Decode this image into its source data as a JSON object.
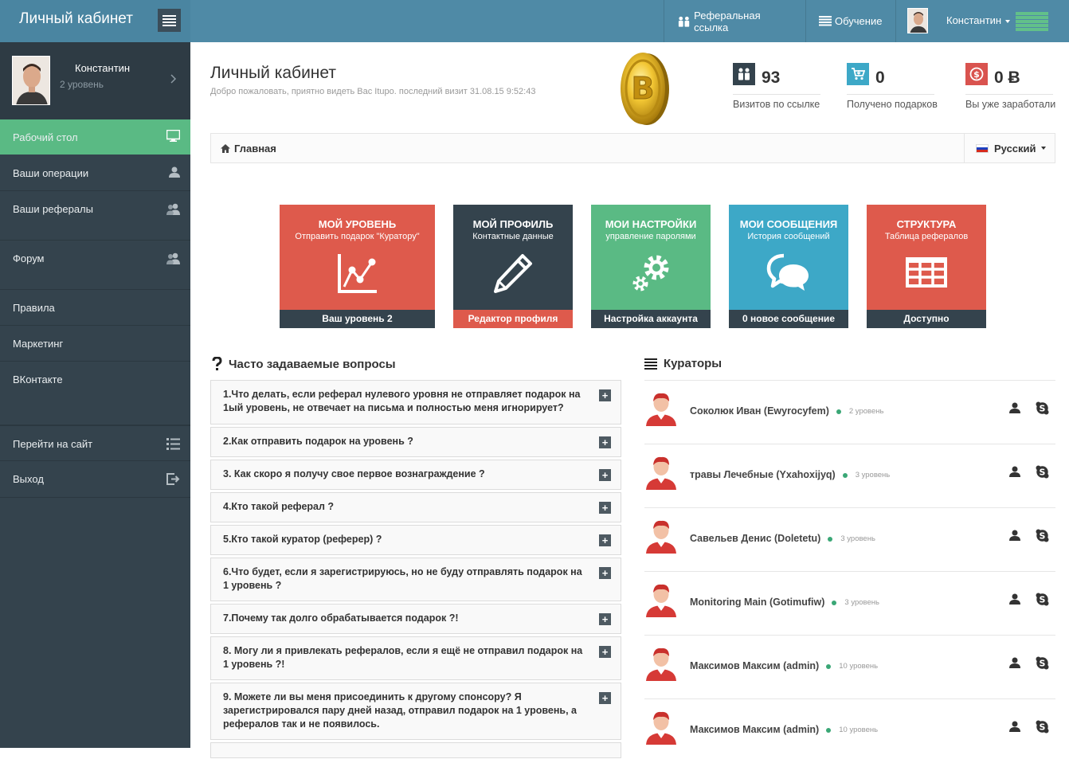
{
  "header": {
    "brand_title": "Личный кабинет",
    "nav": [
      {
        "label": "Реферальная ссылка",
        "icon": "users-icon"
      },
      {
        "label": "Обучение",
        "icon": "list-icon"
      }
    ],
    "user_name": "Константин"
  },
  "sidebar": {
    "profile": {
      "name": "Константин",
      "level": "2 уровень"
    },
    "items": [
      {
        "label": "Рабочий стол",
        "icon": "monitor-icon",
        "active": true
      },
      {
        "label": "Ваши операции",
        "icon": "user-icon"
      },
      {
        "label": "Ваши рефералы",
        "icon": "users-icon"
      },
      {
        "label": "Форум",
        "icon": "users-icon"
      },
      {
        "label": "Правила"
      },
      {
        "label": "Маркетинг"
      },
      {
        "label": "ВКонтакте"
      },
      {
        "label": "Перейти на сайт",
        "icon": "list-icon"
      },
      {
        "label": "Выход",
        "icon": "logout-icon"
      }
    ]
  },
  "page": {
    "title": "Личный кабинет",
    "subtitle": "Добро пожаловать, приятно видеть Вас Itupo. последний визит 31.08.15 9:52:43"
  },
  "stats": [
    {
      "value": "93",
      "label": "Визитов по ссылке",
      "color": "#34434d",
      "icon": "users-icon"
    },
    {
      "value": "0",
      "label": "Получено подарков",
      "color": "#3da8c7",
      "icon": "cart-icon"
    },
    {
      "value": "0 Ƀ",
      "label": "Вы уже заработали",
      "color": "#d9534f",
      "icon": "coin-icon"
    }
  ],
  "breadcrumb": {
    "home": "Главная",
    "language": "Русский"
  },
  "tiles": [
    {
      "title": "Мой уровень",
      "subtitle": "Отправить подарок \"Куратору\"",
      "footer": "Ваш уровень 2",
      "color": "#de5a4c",
      "footer_color": "#34434d",
      "icon": "chart-icon"
    },
    {
      "title": "Мой профиль",
      "subtitle": "Контактные данные",
      "footer": "Редактор профиля",
      "color": "#34434d",
      "footer_color": "#de5a4c",
      "icon": "pencil-icon"
    },
    {
      "title": "Мои настройки",
      "subtitle": "управление паролями",
      "footer": "Настройка аккаунта",
      "color": "#5aba84",
      "footer_color": "#34434d",
      "icon": "gears-icon"
    },
    {
      "title": "Мои сообщения",
      "subtitle": "История сообщений",
      "footer": "0 новое сообщение",
      "color": "#3da8c7",
      "footer_color": "#34434d",
      "icon": "chat-icon"
    },
    {
      "title": "Структура",
      "subtitle": "Таблица рефералов",
      "footer": "Доступно",
      "color": "#de5a4c",
      "footer_color": "#34434d",
      "icon": "table-icon"
    }
  ],
  "faq": {
    "title": "Часто задаваемые вопросы",
    "items": [
      "1.Что делать, если реферал нулевого уровня не отправляет подарок на 1ый уровень, не отвечает на письма и полностью меня игнорирует?",
      "2.Как отправить подарок на уровень ?",
      "3. Как скоро я получу свое первое вознаграждение ?",
      "4.Кто такой реферал ?",
      "5.Кто такой куратор (реферер) ?",
      "6.Что будет, если я зарегистрируюсь, но не буду отправлять подарок на 1 уровень ?",
      "7.Почему так долго обрабатывается подарок ?!",
      "8. Могу ли я привлекать рефералов, если я ещё не отправил подарок на 1 уровень ?!",
      "9. Можете ли вы меня присоединить к другому спонсору? Я зарегистрировался пару дней назад, отправил подарок на 1 уровень, а рефералов так и не появилось."
    ]
  },
  "curators": {
    "title": "Кураторы",
    "items": [
      {
        "name": "Соколюк Иван (Ewyrocyfem)",
        "level": "2 уровень"
      },
      {
        "name": "травы Лечебные (Yxahoxijyq)",
        "level": "3 уровень"
      },
      {
        "name": "Савельев Денис (Doletetu)",
        "level": "3 уровень"
      },
      {
        "name": "Monitoring Main (Gotimufiw)",
        "level": "3 уровень"
      },
      {
        "name": "Максимов Максим (admin)",
        "level": "10 уровень"
      },
      {
        "name": "Максимов Максим (admin)",
        "level": "10 уровень"
      }
    ]
  }
}
